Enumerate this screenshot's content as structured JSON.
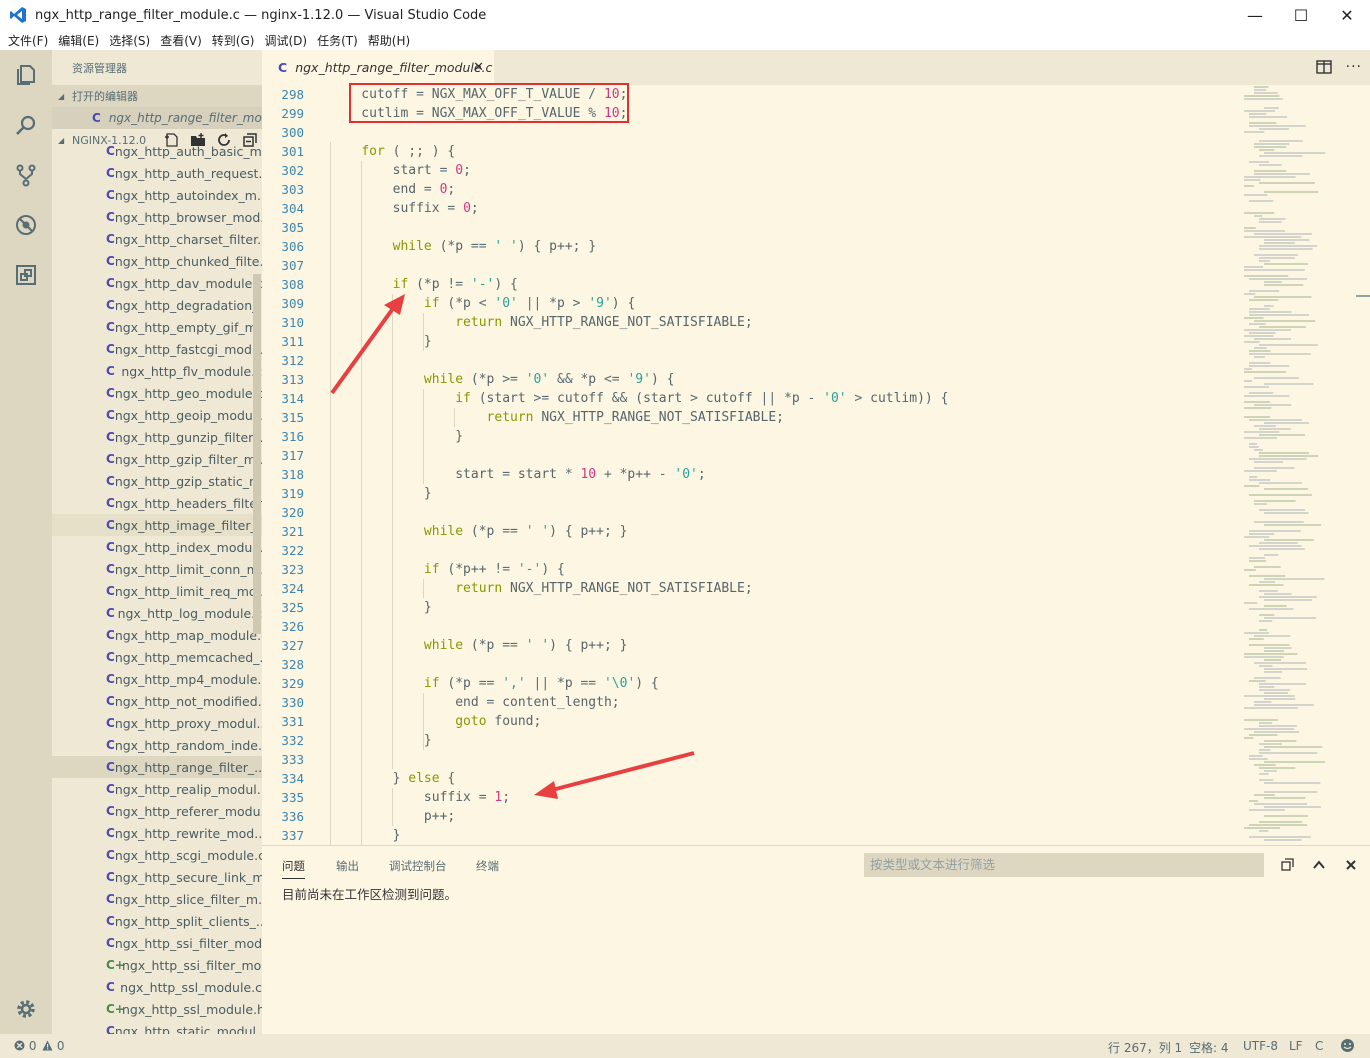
{
  "window": {
    "title": "ngx_http_range_filter_module.c — nginx-1.12.0 — Visual Studio Code",
    "minimize": "—",
    "maximize": "☐",
    "close": "✕"
  },
  "menu": [
    "文件(F)",
    "编辑(E)",
    "选择(S)",
    "查看(V)",
    "转到(G)",
    "调试(D)",
    "任务(T)",
    "帮助(H)"
  ],
  "sidebar": {
    "title": "资源管理器",
    "open_editors_label": "打开的编辑器",
    "open_editor_file": "ngx_http_range_filter_mod...",
    "project_label": "NGINX-1.12.0",
    "files": [
      {
        "icon": "C",
        "name": "ngx_http_auth_basic_m..."
      },
      {
        "icon": "C",
        "name": "ngx_http_auth_request..."
      },
      {
        "icon": "C",
        "name": "ngx_http_autoindex_m..."
      },
      {
        "icon": "C",
        "name": "ngx_http_browser_mod..."
      },
      {
        "icon": "C",
        "name": "ngx_http_charset_filter..."
      },
      {
        "icon": "C",
        "name": "ngx_http_chunked_filte..."
      },
      {
        "icon": "C",
        "name": "ngx_http_dav_module.c"
      },
      {
        "icon": "C",
        "name": "ngx_http_degradation_..."
      },
      {
        "icon": "C",
        "name": "ngx_http_empty_gif_m..."
      },
      {
        "icon": "C",
        "name": "ngx_http_fastcgi_modu..."
      },
      {
        "icon": "C",
        "name": "ngx_http_flv_module.c"
      },
      {
        "icon": "C",
        "name": "ngx_http_geo_module.c"
      },
      {
        "icon": "C",
        "name": "ngx_http_geoip_modul..."
      },
      {
        "icon": "C",
        "name": "ngx_http_gunzip_filter_..."
      },
      {
        "icon": "C",
        "name": "ngx_http_gzip_filter_m..."
      },
      {
        "icon": "C",
        "name": "ngx_http_gzip_static_m..."
      },
      {
        "icon": "C",
        "name": "ngx_http_headers_filter..."
      },
      {
        "icon": "C",
        "name": "ngx_http_image_filter_..."
      },
      {
        "icon": "C",
        "name": "ngx_http_index_modul..."
      },
      {
        "icon": "C",
        "name": "ngx_http_limit_conn_m..."
      },
      {
        "icon": "C",
        "name": "ngx_http_limit_req_mo..."
      },
      {
        "icon": "C",
        "name": "ngx_http_log_module.c"
      },
      {
        "icon": "C",
        "name": "ngx_http_map_module.c"
      },
      {
        "icon": "C",
        "name": "ngx_http_memcached_..."
      },
      {
        "icon": "C",
        "name": "ngx_http_mp4_module.c"
      },
      {
        "icon": "C",
        "name": "ngx_http_not_modified..."
      },
      {
        "icon": "C",
        "name": "ngx_http_proxy_modul..."
      },
      {
        "icon": "C",
        "name": "ngx_http_random_inde..."
      },
      {
        "icon": "C",
        "name": "ngx_http_range_filter_..."
      },
      {
        "icon": "C",
        "name": "ngx_http_realip_modul..."
      },
      {
        "icon": "C",
        "name": "ngx_http_referer_modu..."
      },
      {
        "icon": "C",
        "name": "ngx_http_rewrite_mod..."
      },
      {
        "icon": "C",
        "name": "ngx_http_scgi_module.c"
      },
      {
        "icon": "C",
        "name": "ngx_http_secure_link_m..."
      },
      {
        "icon": "C",
        "name": "ngx_http_slice_filter_m..."
      },
      {
        "icon": "C",
        "name": "ngx_http_split_clients_..."
      },
      {
        "icon": "C",
        "name": "ngx_http_ssi_filter_mod..."
      },
      {
        "icon": "C+",
        "name": "ngx_http_ssi_filter_mod..."
      },
      {
        "icon": "C",
        "name": "ngx_http_ssl_module.c"
      },
      {
        "icon": "C+",
        "name": "ngx_http_ssl_module.h"
      },
      {
        "icon": "C",
        "name": "ngx_http_static_modul..."
      }
    ]
  },
  "tab": {
    "icon": "C",
    "label": "ngx_http_range_filter_module.c",
    "close": "✕"
  },
  "editor": {
    "line_numbers": [
      "298",
      "299",
      "300",
      "301",
      "302",
      "303",
      "304",
      "305",
      "306",
      "307",
      "308",
      "309",
      "310",
      "311",
      "312",
      "313",
      "314",
      "315",
      "316",
      "317",
      "318",
      "319",
      "320",
      "321",
      "322",
      "323",
      "324",
      "325",
      "326",
      "327",
      "328",
      "329",
      "330",
      "331",
      "332",
      "333",
      "334",
      "335",
      "336",
      "337"
    ]
  },
  "panel": {
    "tabs": [
      "问题",
      "输出",
      "调试控制台",
      "终端"
    ],
    "filter_placeholder": "按类型或文本进行筛选",
    "message": "目前尚未在工作区检测到问题。"
  },
  "status": {
    "errors": "0",
    "warnings": "0",
    "position": "行 267，列 1",
    "indent": "空格: 4",
    "encoding": "UTF-8",
    "eol": "LF",
    "language": "C"
  }
}
